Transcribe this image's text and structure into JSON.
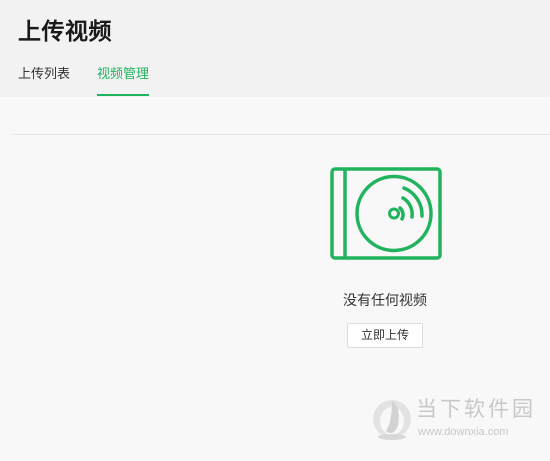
{
  "page": {
    "title": "上传视频"
  },
  "tabs": [
    {
      "label": "上传列表",
      "active": false
    },
    {
      "label": "视频管理",
      "active": true
    }
  ],
  "empty_state": {
    "icon": "video-disc-icon",
    "message": "没有任何视频",
    "action_label": "立即上传"
  },
  "watermark": {
    "name": "当下软件园",
    "url": "www.downxia.com"
  },
  "colors": {
    "accent": "#22b35e",
    "header_bg": "#f2f2f2",
    "body_bg": "#f8f8f8"
  }
}
